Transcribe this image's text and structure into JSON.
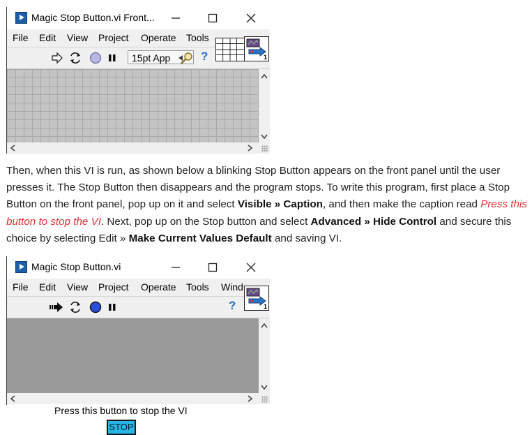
{
  "window1": {
    "title": "Magic Stop Button.vi Front...",
    "menu": [
      "File",
      "Edit",
      "View",
      "Project",
      "Operate",
      "Tools"
    ],
    "font_selector": "15pt App",
    "help_glyph": "?",
    "icon_number": "1"
  },
  "paragraph": {
    "t1": "Then, when this VI is run, as shown below a blinking Stop Button appears on the front panel until the user presses it. The Stop Button then disappears and the program stops. To write this program, first place a Stop Button on the front panel, pop up on it and select ",
    "b1": "Visible » Caption",
    "t2": ", and then make the caption read ",
    "red": "Press this button to stop the VI",
    "t3": ". Next, pop up on the Stop button and select ",
    "b2": "Advanced » Hide Control",
    "t4": " and secure this choice by selecting Edit » ",
    "b3": "Make Current Values Default",
    "t5": " and saving VI."
  },
  "window2": {
    "title": "Magic Stop Button.vi",
    "menu": [
      "File",
      "Edit",
      "View",
      "Project",
      "Operate",
      "Tools",
      "Wind"
    ],
    "help_glyph": "?",
    "icon_number": "1",
    "prompt": "Press this button to stop the VI",
    "stop_label": "STOP"
  },
  "colors": {
    "panel_gray": "#c4c4c4",
    "run_panel_gray": "#9a9a9a",
    "stop_button": "#27b6e8",
    "caption_red": "#e03030",
    "labview_blue": "#1b5fa8"
  },
  "icons": {
    "run": "run-arrow-icon",
    "run_continuous": "run-continuously-icon",
    "abort": "abort-icon",
    "pause": "pause-icon",
    "search": "search-icon",
    "help": "context-help-icon"
  }
}
